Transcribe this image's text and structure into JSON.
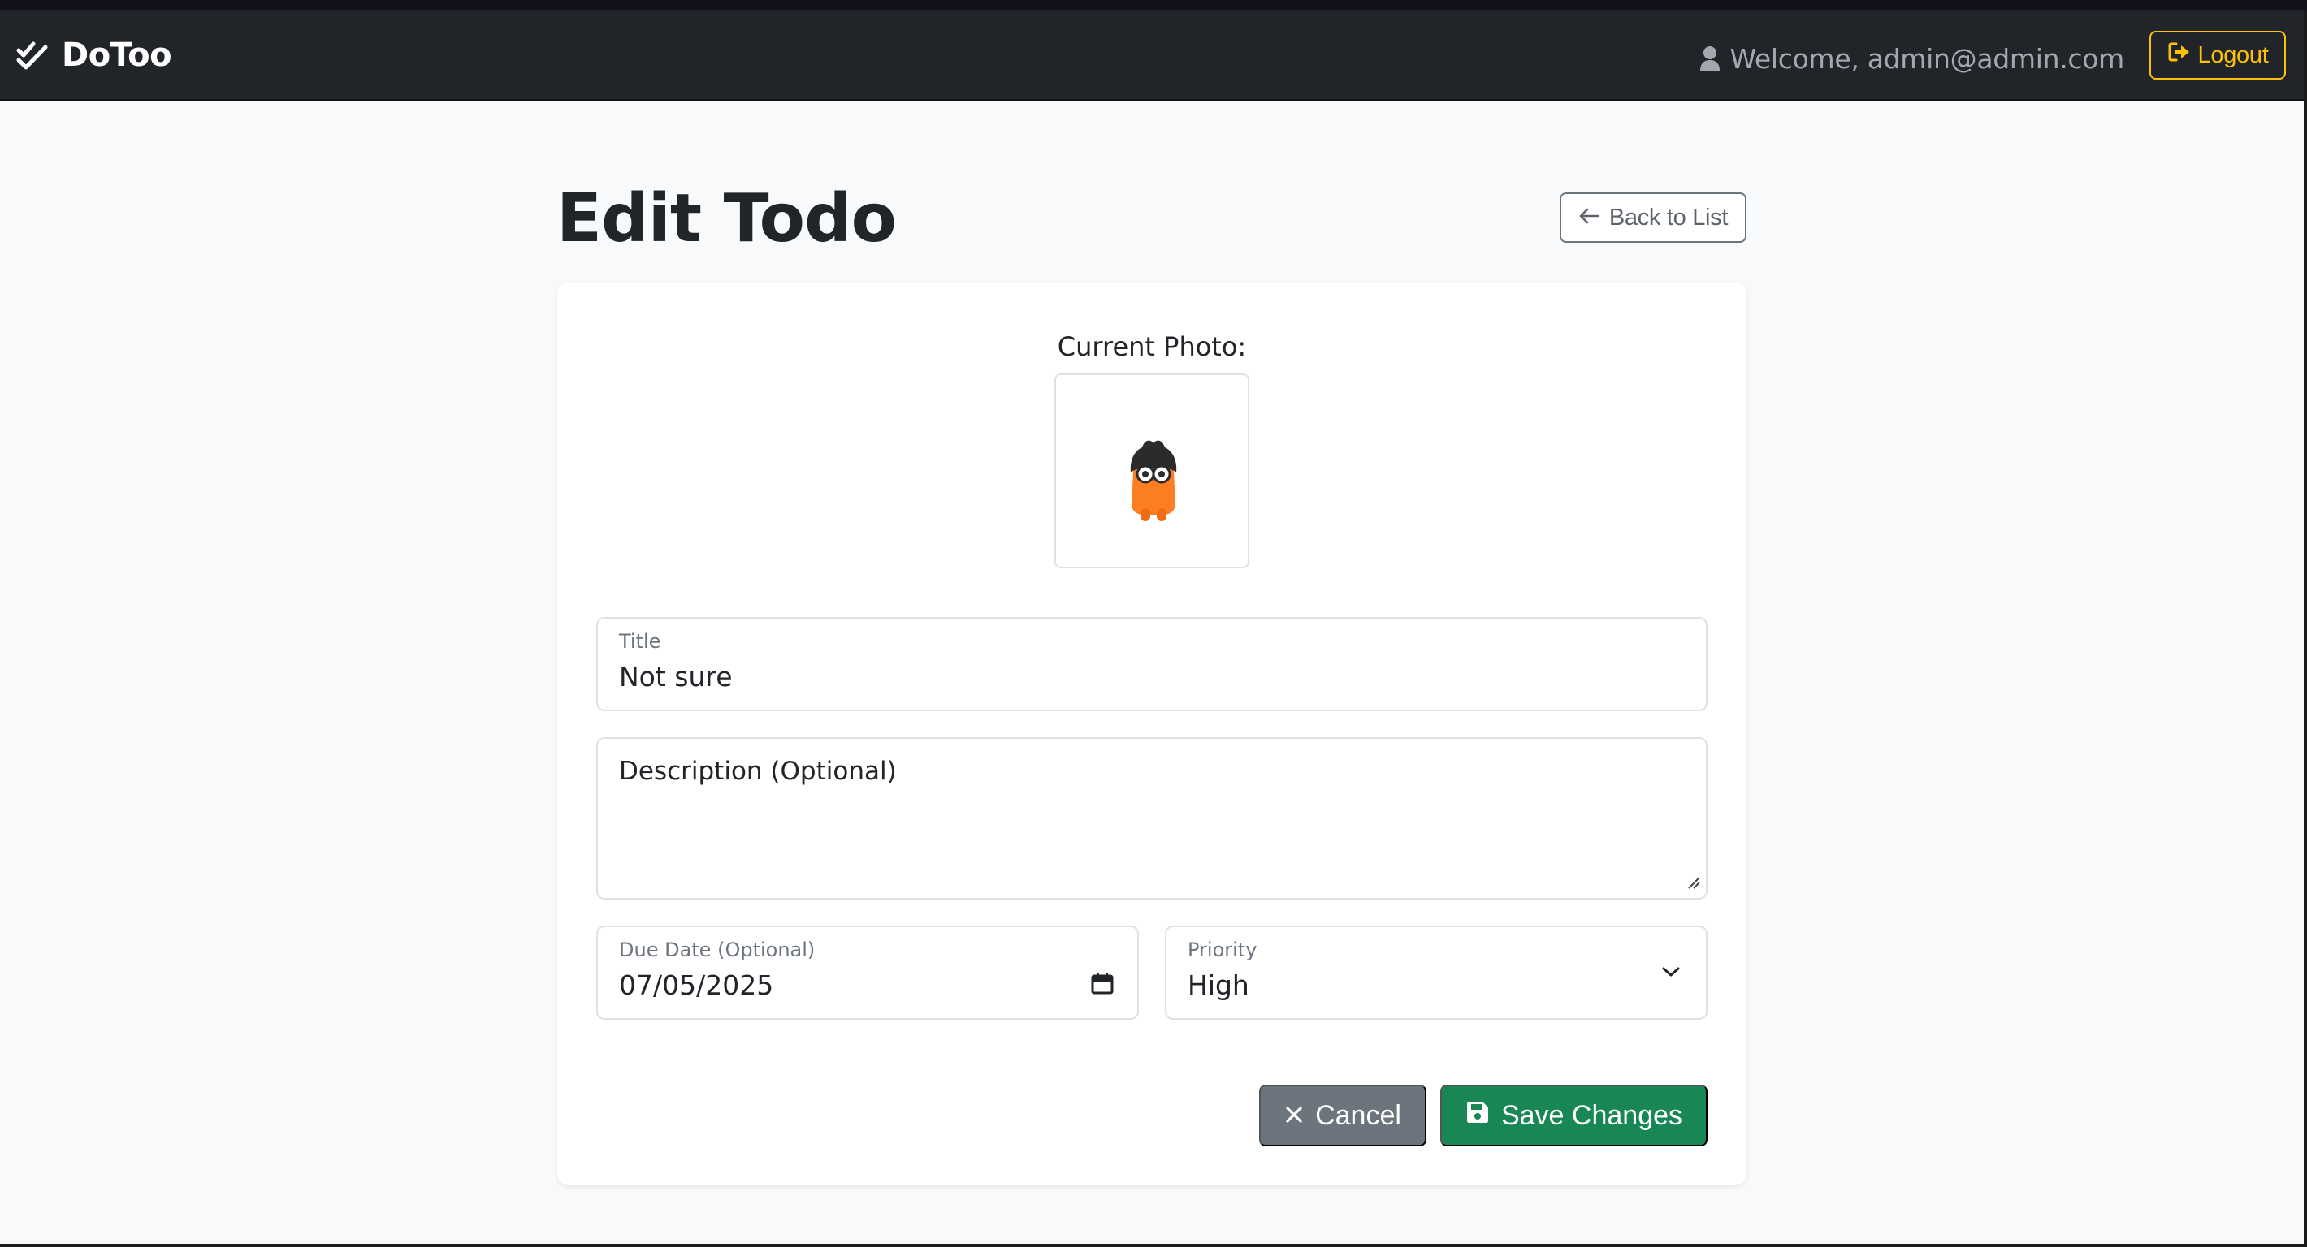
{
  "navbar": {
    "brand": "DoToo",
    "welcome": "Welcome, admin@admin.com",
    "logout_label": "Logout"
  },
  "page": {
    "title": "Edit Todo",
    "back_label": "Back to List"
  },
  "form": {
    "current_photo_label": "Current Photo:",
    "title_label": "Title",
    "title_value": "Not sure",
    "description_placeholder": "Description (Optional)",
    "due_date_label": "Due Date (Optional)",
    "due_date_value": "07/05/2025",
    "priority_label": "Priority",
    "priority_value": "High",
    "cancel_label": "Cancel",
    "save_label": "Save Changes"
  },
  "icons": {
    "brand": "double-check-icon",
    "user": "user-icon",
    "logout": "logout-icon",
    "back": "arrow-left-icon",
    "calendar": "calendar-icon",
    "dropdown": "chevron-down-icon",
    "cancel": "close-icon",
    "save": "floppy-disk-icon"
  },
  "colors": {
    "navbar_bg": "#212529",
    "logout": "#ffc107",
    "cancel": "#6c757d",
    "save": "#198754",
    "page_bg": "#f8f9fa"
  }
}
